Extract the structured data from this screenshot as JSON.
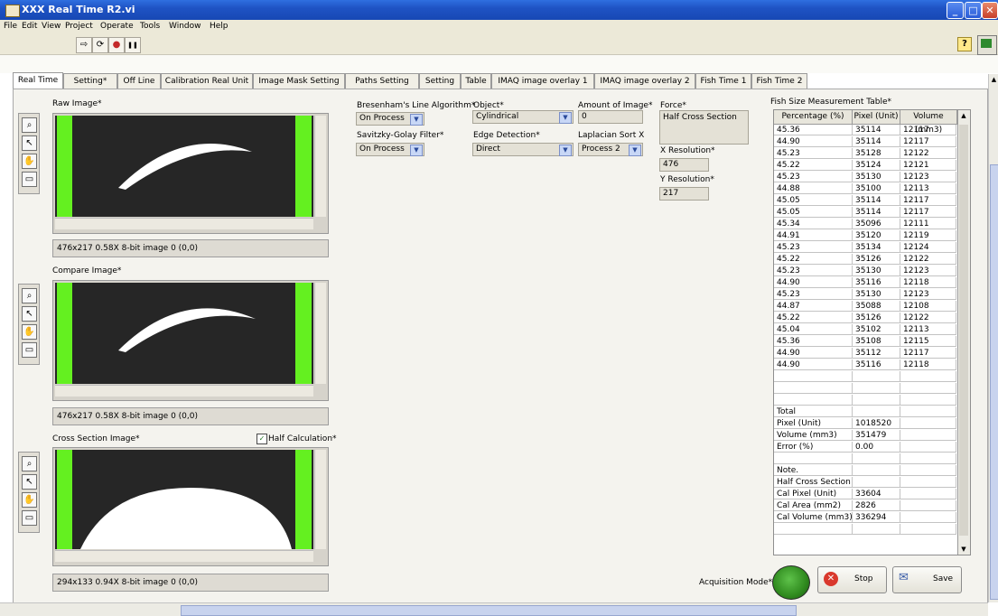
{
  "window": {
    "title": "XXX Real Time R2.vi"
  },
  "menu": [
    "File",
    "Edit",
    "View",
    "Project",
    "Operate",
    "Tools",
    "Window",
    "Help"
  ],
  "toolbar": {
    "run": "⇨",
    "run_continuous": "⟳",
    "abort": "●",
    "pause": "❚❚",
    "help": "?"
  },
  "tabs": [
    {
      "label": "Real Time",
      "active": true
    },
    {
      "label": "Setting*"
    },
    {
      "label": "Off Line"
    },
    {
      "label": "Calibration Real Unit"
    },
    {
      "label": "Image Mask Setting"
    },
    {
      "label": "Paths Setting"
    },
    {
      "label": "Setting"
    },
    {
      "label": "Table"
    },
    {
      "label": "IMAQ image overlay 1"
    },
    {
      "label": "IMAQ image overlay 2"
    },
    {
      "label": "Fish Time 1"
    },
    {
      "label": "Fish Time 2"
    }
  ],
  "raw_image": {
    "label": "Raw Image*",
    "status": "476x217 0.58X 8-bit image 0   (0,0)"
  },
  "compare_image": {
    "label": "Compare Image*",
    "status": "476x217 0.58X 8-bit image 0   (0,0)"
  },
  "cross_section": {
    "label": "Cross Section Image*",
    "status": "294x133 0.94X 8-bit image 0   (0,0)",
    "half_calc_label": "Half Calculation*",
    "half_calc_checked": true
  },
  "controls": {
    "bresenham": {
      "label": "Bresenham's Line Algorithm*",
      "value": "On Process"
    },
    "savitzky": {
      "label": "Savitzky-Golay Filter*",
      "value": "On Process"
    },
    "object": {
      "label": "Object*",
      "value": "Cylindrical"
    },
    "edge": {
      "label": "Edge Detection*",
      "value": "Direct"
    },
    "amount": {
      "label": "Amount of Image*",
      "value": "0"
    },
    "laplacian": {
      "label": "Laplacian Sort X",
      "value": "Process 2"
    },
    "force": {
      "label": "Force*",
      "value": "Half Cross Section"
    },
    "xres": {
      "label": "X Resolution*",
      "value": "476"
    },
    "yres": {
      "label": "Y Resolution*",
      "value": "217"
    }
  },
  "table": {
    "title": "Fish Size Measurement Table*",
    "headers": [
      "Percentage (%)",
      "Pixel (Unit)",
      "Volume (mm3)"
    ],
    "rows": [
      [
        "45.36",
        "35114",
        "12117"
      ],
      [
        "44.90",
        "35114",
        "12117"
      ],
      [
        "45.23",
        "35128",
        "12122"
      ],
      [
        "45.22",
        "35124",
        "12121"
      ],
      [
        "45.23",
        "35130",
        "12123"
      ],
      [
        "44.88",
        "35100",
        "12113"
      ],
      [
        "45.05",
        "35114",
        "12117"
      ],
      [
        "45.05",
        "35114",
        "12117"
      ],
      [
        "45.34",
        "35096",
        "12111"
      ],
      [
        "44.91",
        "35120",
        "12119"
      ],
      [
        "45.23",
        "35134",
        "12124"
      ],
      [
        "45.22",
        "35126",
        "12122"
      ],
      [
        "45.23",
        "35130",
        "12123"
      ],
      [
        "44.90",
        "35116",
        "12118"
      ],
      [
        "45.23",
        "35130",
        "12123"
      ],
      [
        "44.87",
        "35088",
        "12108"
      ],
      [
        "45.22",
        "35126",
        "12122"
      ],
      [
        "45.04",
        "35102",
        "12113"
      ],
      [
        "45.36",
        "35108",
        "12115"
      ],
      [
        "44.90",
        "35112",
        "12117"
      ],
      [
        "44.90",
        "35116",
        "12118"
      ],
      [
        "",
        "",
        ""
      ],
      [
        "",
        "",
        ""
      ],
      [
        "",
        "",
        ""
      ],
      [
        "Total",
        "",
        ""
      ],
      [
        "Pixel (Unit)",
        "1018520",
        ""
      ],
      [
        "Volume (mm3)",
        "351479",
        ""
      ],
      [
        "Error (%)",
        "0.00",
        ""
      ],
      [
        "",
        "",
        ""
      ],
      [
        "Note.",
        "",
        ""
      ],
      [
        "Half Cross Section",
        "",
        ""
      ],
      [
        "Cal Pixel (Unit)",
        "33604",
        ""
      ],
      [
        "Cal Area (mm2)",
        "2826",
        ""
      ],
      [
        "Cal Volume (mm3)",
        "336294",
        ""
      ],
      [
        "",
        "",
        ""
      ]
    ]
  },
  "acquisition": {
    "label": "Acquisition Mode*",
    "stop": "Stop",
    "save": "Save"
  },
  "colors": {
    "titlebar": "#1f53c4",
    "green_strip": "#64f020",
    "panel": "#f4f3ee",
    "acq_led": "#2f8a1e"
  }
}
